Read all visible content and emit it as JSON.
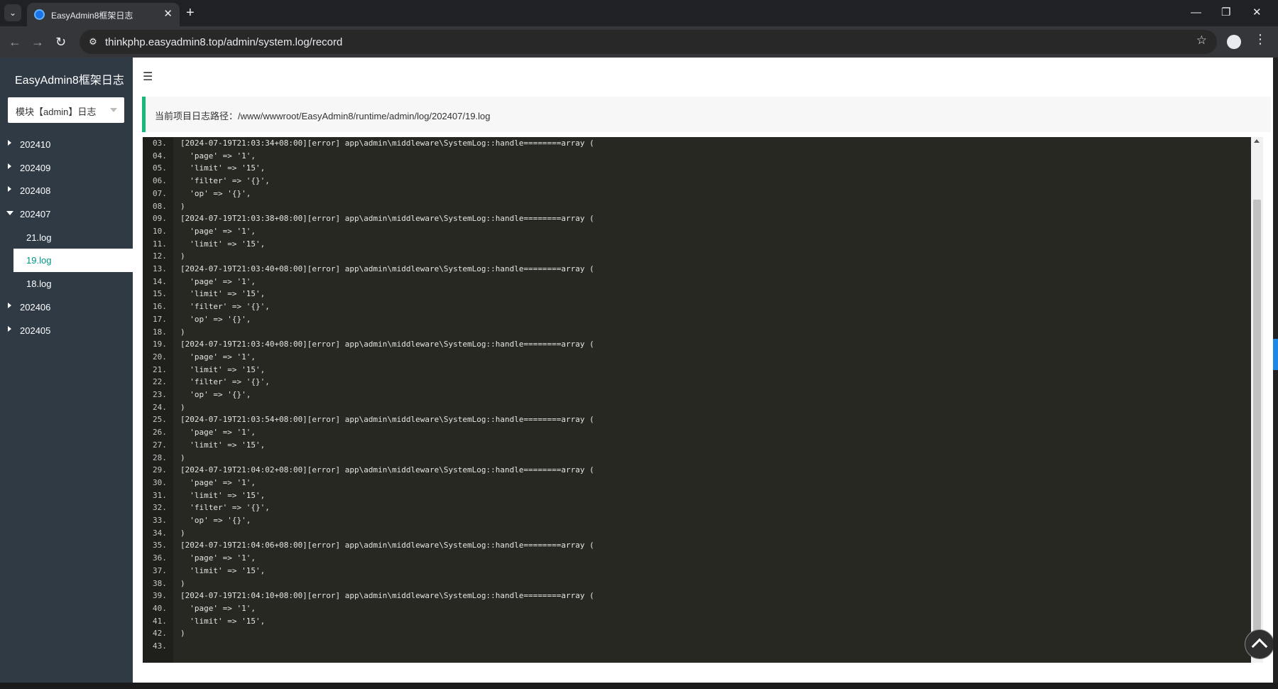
{
  "browser": {
    "tab_title": "EasyAdmin8框架日志",
    "url": "thinkphp.easyadmin8.top/admin/system.log/record",
    "tab_close_glyph": "✕",
    "new_tab_glyph": "+",
    "minimize_glyph": "—",
    "restore_glyph": "❐",
    "close_glyph": "✕",
    "back_glyph": "←",
    "forward_glyph": "→",
    "reload_glyph": "↻",
    "star_glyph": "☆",
    "menu_glyph": "⋮",
    "tab_list_glyph": "⌄"
  },
  "sidebar": {
    "title": "EasyAdmin8框架日志",
    "module_select": "模块【admin】日志",
    "tree": [
      {
        "label": "202410",
        "open": false
      },
      {
        "label": "202409",
        "open": false
      },
      {
        "label": "202408",
        "open": false
      },
      {
        "label": "202407",
        "open": true,
        "children": [
          "21.log",
          "19.log",
          "18.log"
        ],
        "active_child": "19.log"
      },
      {
        "label": "202406",
        "open": false
      },
      {
        "label": "202405",
        "open": false
      }
    ]
  },
  "main": {
    "menu_glyph": "☰",
    "path_label": "当前项目日志路径：/www/wwwroot/EasyAdmin8/runtime/admin/log/202407/19.log"
  },
  "log": [
    {
      "n": "03.",
      "t": "[2024-07-19T21:03:34+08:00][error] app\\admin\\middleware\\SystemLog::handle========array ("
    },
    {
      "n": "04.",
      "t": "  'page' => '1',"
    },
    {
      "n": "05.",
      "t": "  'limit' => '15',"
    },
    {
      "n": "06.",
      "t": "  'filter' => '{}',"
    },
    {
      "n": "07.",
      "t": "  'op' => '{}',"
    },
    {
      "n": "08.",
      "t": ")"
    },
    {
      "n": "09.",
      "t": "[2024-07-19T21:03:38+08:00][error] app\\admin\\middleware\\SystemLog::handle========array ("
    },
    {
      "n": "10.",
      "t": "  'page' => '1',"
    },
    {
      "n": "11.",
      "t": "  'limit' => '15',"
    },
    {
      "n": "12.",
      "t": ")"
    },
    {
      "n": "13.",
      "t": "[2024-07-19T21:03:40+08:00][error] app\\admin\\middleware\\SystemLog::handle========array ("
    },
    {
      "n": "14.",
      "t": "  'page' => '1',"
    },
    {
      "n": "15.",
      "t": "  'limit' => '15',"
    },
    {
      "n": "16.",
      "t": "  'filter' => '{}',"
    },
    {
      "n": "17.",
      "t": "  'op' => '{}',"
    },
    {
      "n": "18.",
      "t": ")"
    },
    {
      "n": "19.",
      "t": "[2024-07-19T21:03:40+08:00][error] app\\admin\\middleware\\SystemLog::handle========array ("
    },
    {
      "n": "20.",
      "t": "  'page' => '1',"
    },
    {
      "n": "21.",
      "t": "  'limit' => '15',"
    },
    {
      "n": "22.",
      "t": "  'filter' => '{}',"
    },
    {
      "n": "23.",
      "t": "  'op' => '{}',"
    },
    {
      "n": "24.",
      "t": ")"
    },
    {
      "n": "25.",
      "t": "[2024-07-19T21:03:54+08:00][error] app\\admin\\middleware\\SystemLog::handle========array ("
    },
    {
      "n": "26.",
      "t": "  'page' => '1',"
    },
    {
      "n": "27.",
      "t": "  'limit' => '15',"
    },
    {
      "n": "28.",
      "t": ")"
    },
    {
      "n": "29.",
      "t": "[2024-07-19T21:04:02+08:00][error] app\\admin\\middleware\\SystemLog::handle========array ("
    },
    {
      "n": "30.",
      "t": "  'page' => '1',"
    },
    {
      "n": "31.",
      "t": "  'limit' => '15',"
    },
    {
      "n": "32.",
      "t": "  'filter' => '{}',"
    },
    {
      "n": "33.",
      "t": "  'op' => '{}',"
    },
    {
      "n": "34.",
      "t": ")"
    },
    {
      "n": "35.",
      "t": "[2024-07-19T21:04:06+08:00][error] app\\admin\\middleware\\SystemLog::handle========array ("
    },
    {
      "n": "36.",
      "t": "  'page' => '1',"
    },
    {
      "n": "37.",
      "t": "  'limit' => '15',"
    },
    {
      "n": "38.",
      "t": ")"
    },
    {
      "n": "39.",
      "t": "[2024-07-19T21:04:10+08:00][error] app\\admin\\middleware\\SystemLog::handle========array ("
    },
    {
      "n": "40.",
      "t": "  'page' => '1',"
    },
    {
      "n": "41.",
      "t": "  'limit' => '15',"
    },
    {
      "n": "42.",
      "t": ")"
    },
    {
      "n": "43.",
      "t": ""
    }
  ]
}
